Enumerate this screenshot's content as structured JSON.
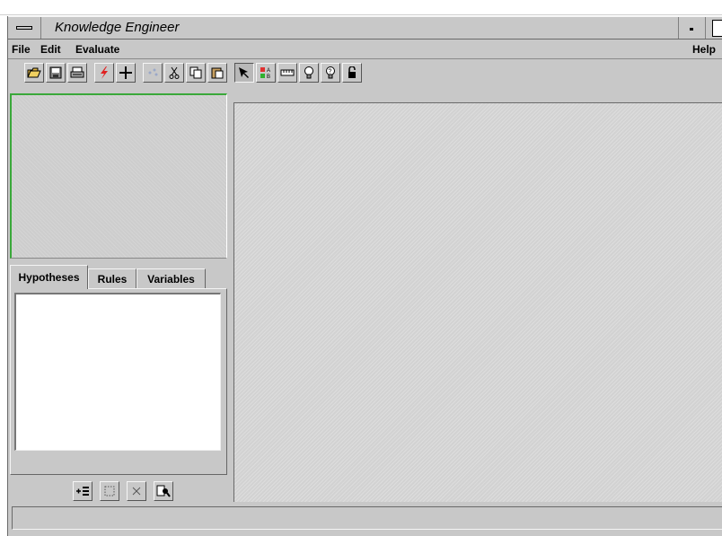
{
  "window": {
    "title": "Knowledge Engineer"
  },
  "menubar": {
    "file": "File",
    "edit": "Edit",
    "evaluate": "Evaluate",
    "help": "Help"
  },
  "toolbar": {
    "buttons": [
      {
        "name": "open-icon"
      },
      {
        "name": "save-icon"
      },
      {
        "name": "print-icon"
      },
      {
        "name": "lightning-icon"
      },
      {
        "name": "add-icon"
      },
      {
        "name": "sparkle-icon"
      },
      {
        "name": "cut-icon"
      },
      {
        "name": "copy-icon"
      },
      {
        "name": "paste-icon"
      },
      {
        "name": "pointer-icon"
      },
      {
        "name": "ab-color-icon"
      },
      {
        "name": "ruler-icon"
      },
      {
        "name": "lightbulb-icon"
      },
      {
        "name": "lightbulb-question-icon"
      },
      {
        "name": "lock-icon"
      }
    ],
    "colors": {
      "lightning": "#e02020",
      "pointer": "#000000"
    }
  },
  "tabs": {
    "hypotheses": "Hypotheses",
    "rules": "Rules",
    "variables": "Variables"
  },
  "list_buttons": [
    {
      "name": "add-item-icon"
    },
    {
      "name": "select-box-icon"
    },
    {
      "name": "delete-item-icon"
    },
    {
      "name": "find-icon"
    }
  ],
  "status": {
    "text": ""
  },
  "colors": {
    "tree_border": "#3aa83a",
    "window_bg": "#c8c8c8"
  }
}
